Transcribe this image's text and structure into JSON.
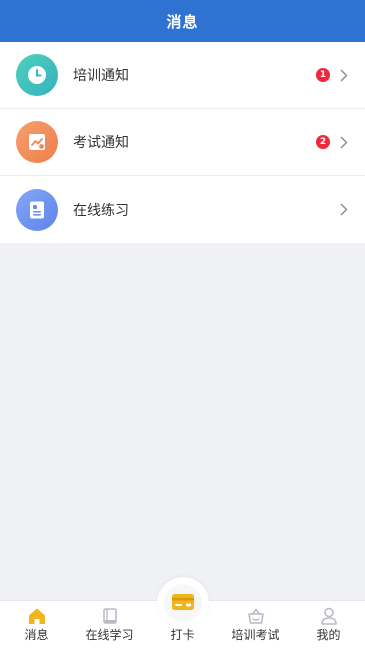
{
  "header": {
    "title": "消息"
  },
  "list": [
    {
      "label": "培训通知",
      "badge": "1",
      "icon": "clock-icon",
      "color": "#3fc3b6"
    },
    {
      "label": "考试通知",
      "badge": "2",
      "icon": "chart-icon",
      "color": "#f28c5a"
    },
    {
      "label": "在线练习",
      "badge": "",
      "icon": "document-icon",
      "color": "#6f94f1"
    }
  ],
  "tabbar": {
    "items": [
      {
        "label": "消息",
        "icon": "home-icon",
        "active": true
      },
      {
        "label": "在线学习",
        "icon": "book-icon",
        "active": false
      },
      {
        "label": "打卡",
        "icon": "card-icon",
        "active": false
      },
      {
        "label": "培训考试",
        "icon": "basket-icon",
        "active": false
      },
      {
        "label": "我的",
        "icon": "user-icon",
        "active": false
      }
    ]
  },
  "colors": {
    "header": "#2e72d2",
    "badge": "#f0283a",
    "accent": "#f2b51b"
  }
}
